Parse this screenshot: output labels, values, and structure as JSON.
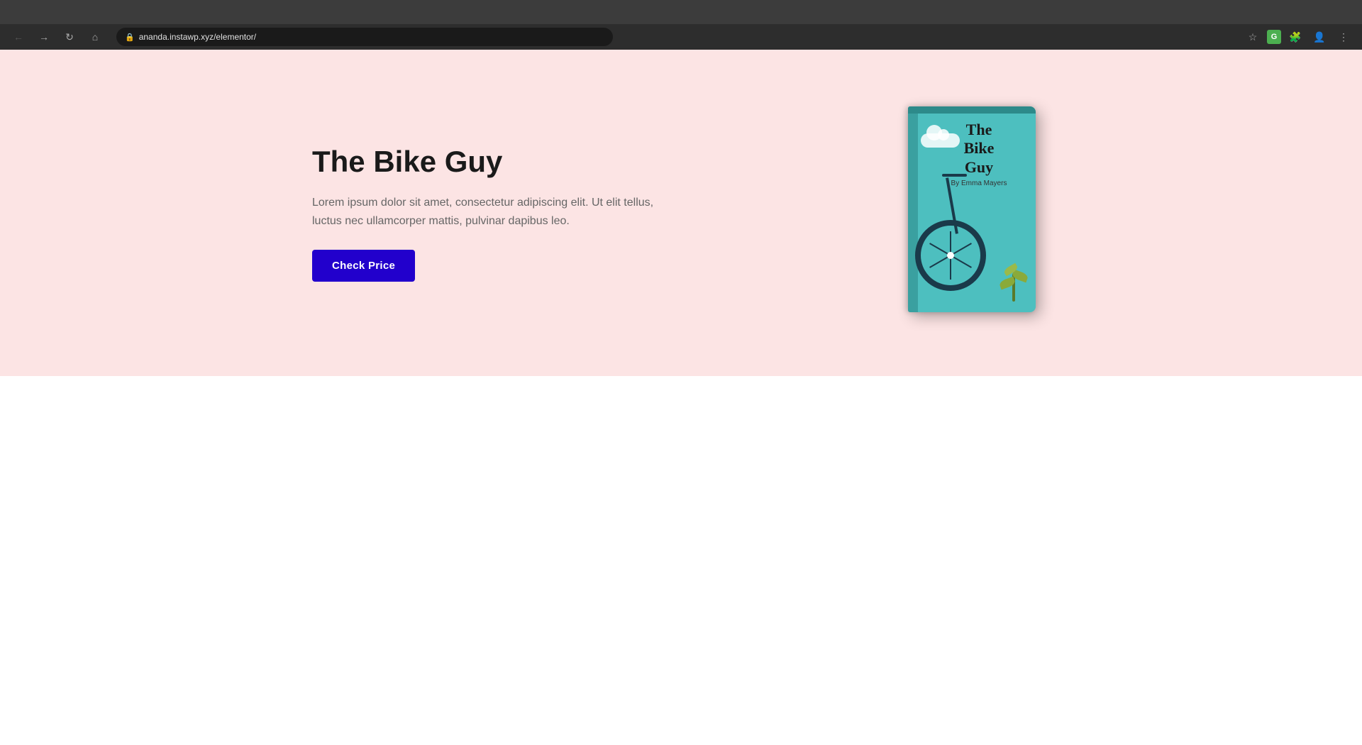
{
  "browser": {
    "url": "ananda.instawp.xyz/elementor/",
    "back_label": "←",
    "forward_label": "→",
    "reload_label": "↻",
    "home_label": "⌂"
  },
  "hero": {
    "title": "The Bike Guy",
    "description": "Lorem ipsum dolor sit amet, consectetur adipiscing elit. Ut elit tellus, luctus nec ullamcorper mattis, pulvinar dapibus leo.",
    "button_label": "Check Price",
    "book_title_line1": "The",
    "book_title_line2": "Bike",
    "book_title_line3": "Guy",
    "book_author": "By Emma Mayers"
  }
}
